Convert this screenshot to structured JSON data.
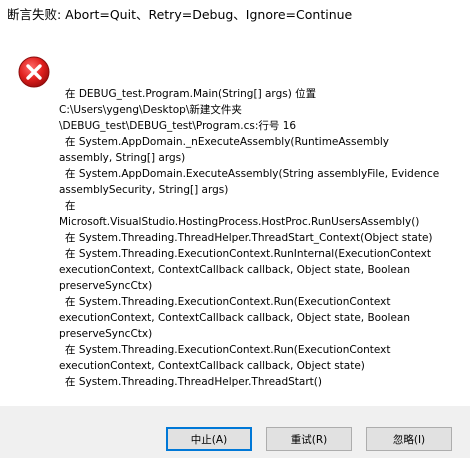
{
  "window": {
    "title": "断言失败: Abort=Quit、Retry=Debug、Ignore=Continue"
  },
  "icon": "error-icon",
  "message": {
    "lines": [
      "在 DEBUG_test.Program.Main(String[] args) 位置",
      "C:\\Users\\ygeng\\Desktop\\新建文件夹",
      "\\DEBUG_test\\DEBUG_test\\Program.cs:行号 16",
      "在 System.AppDomain._nExecuteAssembly(RuntimeAssembly",
      "assembly, String[] args)",
      "在 System.AppDomain.ExecuteAssembly(String assemblyFile, Evidence",
      "assemblySecurity, String[] args)",
      "在",
      "Microsoft.VisualStudio.HostingProcess.HostProc.RunUsersAssembly()",
      "在 System.Threading.ThreadHelper.ThreadStart_Context(Object state)",
      "在 System.Threading.ExecutionContext.RunInternal(ExecutionContext",
      "executionContext, ContextCallback callback, Object state, Boolean",
      "preserveSyncCtx)",
      "在 System.Threading.ExecutionContext.Run(ExecutionContext",
      "executionContext, ContextCallback callback, Object state, Boolean",
      "preserveSyncCtx)",
      "在 System.Threading.ExecutionContext.Run(ExecutionContext",
      "executionContext, ContextCallback callback, Object state)",
      "在 System.Threading.ThreadHelper.ThreadStart()"
    ]
  },
  "buttons": {
    "abort": "中止(A)",
    "retry": "重试(R)",
    "ignore": "忽略(I)"
  },
  "colors": {
    "error_red": "#e81123",
    "footer_bg": "#f0f0f0",
    "button_bg": "#e1e1e1",
    "default_border": "#0078d7"
  }
}
